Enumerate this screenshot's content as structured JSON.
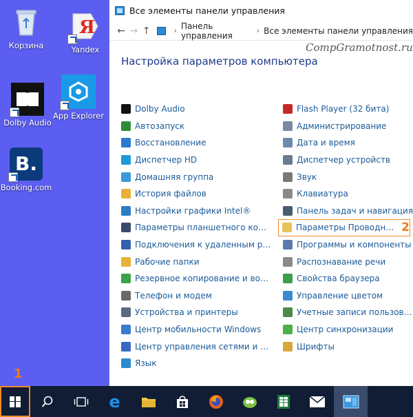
{
  "desktop": {
    "icons": [
      {
        "label": "Корзина"
      },
      {
        "label": "Yandex"
      },
      {
        "label": "Dolby Audio"
      },
      {
        "label": "App Explorer"
      },
      {
        "label": "Booking.com"
      }
    ]
  },
  "window": {
    "title": "Все элементы панели управления",
    "breadcrumb": [
      "Панель управления",
      "Все элементы панели управления"
    ],
    "watermark": "CompGramotnost.ru",
    "heading": "Настройка параметров компьютера",
    "left_items": [
      {
        "label": "Dolby Audio",
        "color": "#111111"
      },
      {
        "label": "Автозапуск",
        "color": "#2e8b3a"
      },
      {
        "label": "Восстановление",
        "color": "#2a7bd0"
      },
      {
        "label": "Диспетчер HD",
        "color": "#1e9ad6"
      },
      {
        "label": "Домашняя группа",
        "color": "#3a9ad9"
      },
      {
        "label": "История файлов",
        "color": "#e8b23a"
      },
      {
        "label": "Настройки графики Intel®",
        "color": "#2b7dc4"
      },
      {
        "label": "Параметры планшетного компьют...",
        "color": "#3b4a6a"
      },
      {
        "label": "Подключения к удаленным рабоч...",
        "color": "#3560b0"
      },
      {
        "label": "Рабочие папки",
        "color": "#e8b23a"
      },
      {
        "label": "Резервное копирование и восстан...",
        "color": "#3aa44a"
      },
      {
        "label": "Телефон и модем",
        "color": "#6a6a6a"
      },
      {
        "label": "Устройства и принтеры",
        "color": "#5a6a80"
      },
      {
        "label": "Центр мобильности Windows",
        "color": "#3a7ad0"
      },
      {
        "label": "Центр управления сетями и общи...",
        "color": "#3a6ac0"
      },
      {
        "label": "Язык",
        "color": "#2a8ad0"
      }
    ],
    "right_items": [
      {
        "label": "Flash Player (32 бита)",
        "color": "#c62828"
      },
      {
        "label": "Администрирование",
        "color": "#7a8aa0"
      },
      {
        "label": "Дата и время",
        "color": "#6a8ab0"
      },
      {
        "label": "Диспетчер устройств",
        "color": "#6a7a90"
      },
      {
        "label": "Звук",
        "color": "#7a7a7a"
      },
      {
        "label": "Клавиатура",
        "color": "#8a8a8a"
      },
      {
        "label": "Панель задач и навигация",
        "color": "#4a5a70"
      },
      {
        "label": "Параметры Проводника",
        "color": "#e8c25a",
        "highlight": true,
        "marker": "2"
      },
      {
        "label": "Программы и компоненты",
        "color": "#5a7ab0"
      },
      {
        "label": "Распознавание речи",
        "color": "#8a8a8a"
      },
      {
        "label": "Свойства браузера",
        "color": "#3aa04a"
      },
      {
        "label": "Управление цветом",
        "color": "#3a8ad0"
      },
      {
        "label": "Учетные записи пользователей",
        "color": "#4a8a4a"
      },
      {
        "label": "Центр синхронизации",
        "color": "#4ab04a"
      },
      {
        "label": "Шрифты",
        "color": "#d8a83a"
      }
    ]
  },
  "taskbar": {
    "start_marker": "1",
    "buttons": [
      "start-button",
      "search-button",
      "task-view-button",
      "edge-button",
      "file-explorer-button",
      "store-button",
      "firefox-button",
      "evernote-button",
      "excel-button",
      "mail-button",
      "control-panel-button"
    ]
  }
}
